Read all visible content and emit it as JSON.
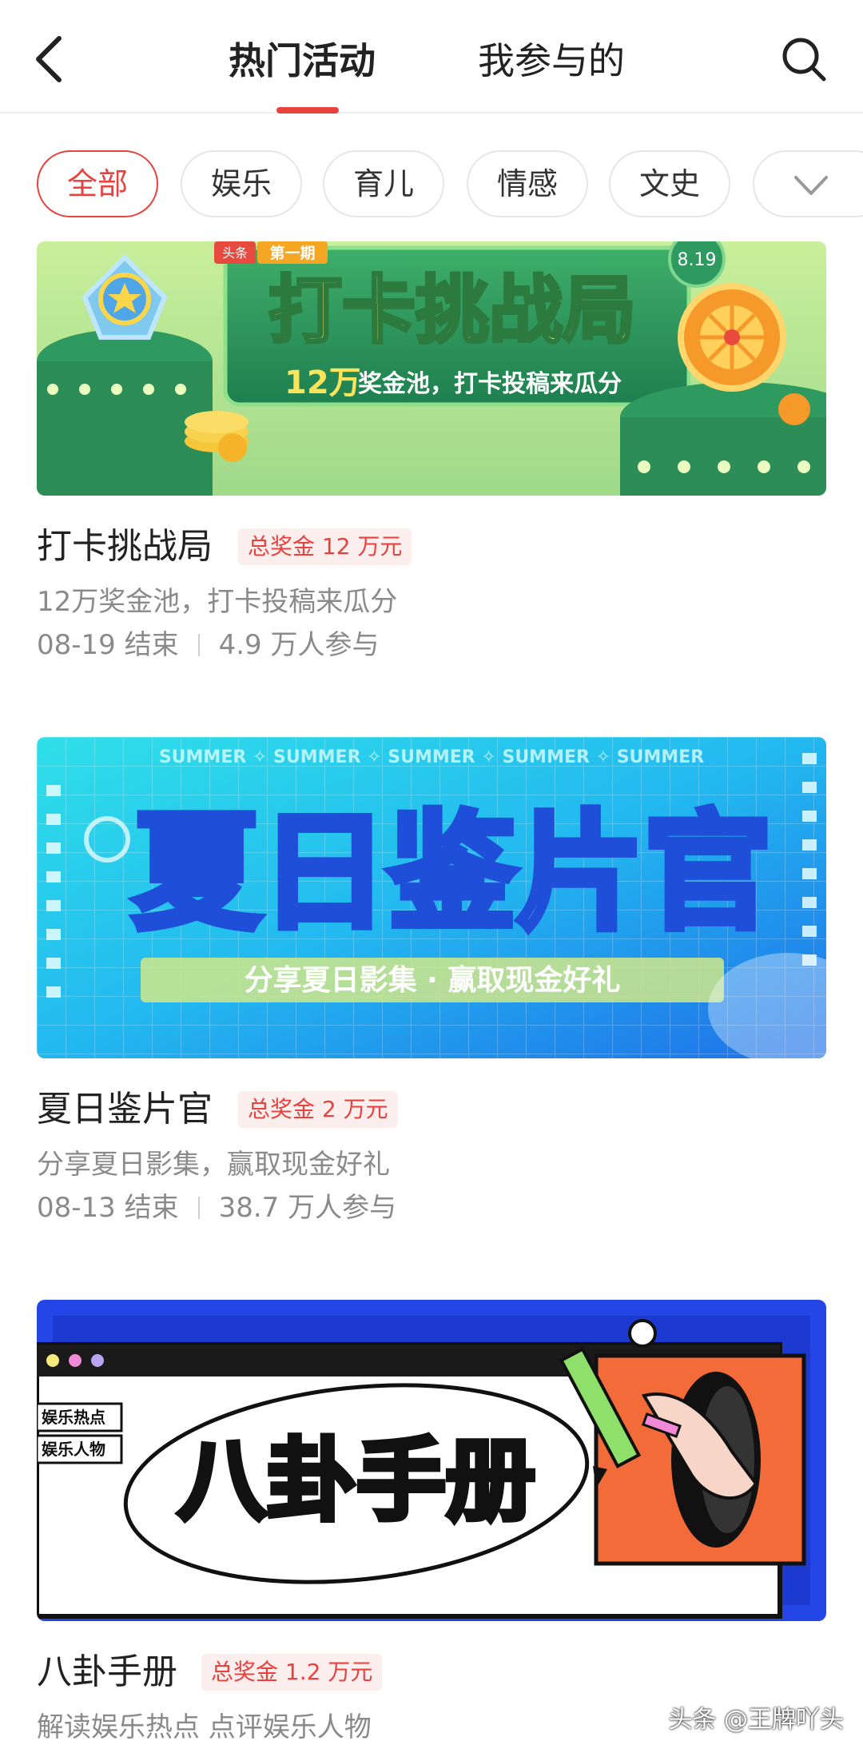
{
  "header": {
    "tabs": [
      {
        "label": "热门活动",
        "active": true
      },
      {
        "label": "我参与的",
        "active": false
      }
    ],
    "back_icon": "back-arrow-icon",
    "search_icon": "search-icon",
    "accent_color": "#e8423f"
  },
  "filters": {
    "chips": [
      {
        "label": "全部",
        "active": true
      },
      {
        "label": "娱乐",
        "active": false
      },
      {
        "label": "育儿",
        "active": false
      },
      {
        "label": "情感",
        "active": false
      },
      {
        "label": "文史",
        "active": false
      }
    ],
    "more_icon": "chevron-down-icon"
  },
  "cards": [
    {
      "banner": {
        "title": "打卡挑战局",
        "tag": "头条",
        "issue": "第一期",
        "date": "8.19",
        "slogan_highlight": "12万",
        "slogan": "奖金池，打卡投稿来瓜分"
      },
      "title": "打卡挑战局",
      "prize": "总奖金  12  万元",
      "desc": "12万奖金池，打卡投稿来瓜分",
      "end": "08-19  结束",
      "participants": "4.9  万人参与"
    },
    {
      "banner": {
        "title": "夏日鉴片官",
        "marquee": "SUMMER  ✧  SUMMER  ✧  SUMMER  ✧  SUMMER  ✧  SUMMER",
        "slogan": "分享夏日影集 · 赢取现金好礼"
      },
      "title": "夏日鉴片官",
      "prize": "总奖金  2  万元",
      "desc": "分享夏日影集，赢取现金好礼",
      "end": "08-13  结束",
      "participants": "38.7  万人参与"
    },
    {
      "banner": {
        "title": "八卦手册",
        "side_label_1": "娱乐热点",
        "side_label_2": "娱乐人物"
      },
      "title": "八卦手册",
      "prize": "总奖金  1.2  万元",
      "desc": "解读娱乐热点  点评娱乐人物"
    }
  ],
  "watermark": "头条 @王牌吖头"
}
